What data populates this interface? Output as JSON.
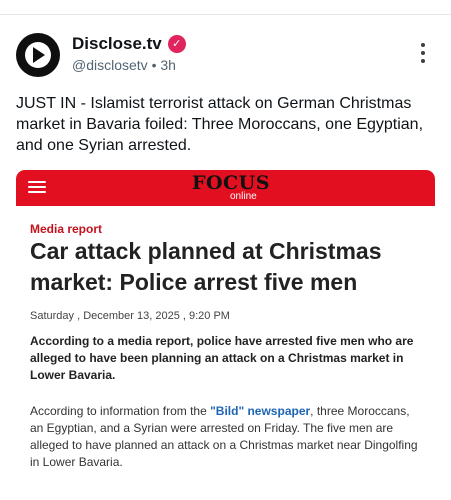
{
  "post": {
    "author": {
      "display_name": "Disclose.tv",
      "verified_mark": "✓",
      "handle": "@disclosetv",
      "separator": "•",
      "time": "3h"
    },
    "text": "JUST IN - Islamist terrorist attack on German Christmas market in Bavaria foiled: Three Moroccans, one Egyptian, and one Syrian arrested."
  },
  "card": {
    "logo_main": "FOCUS",
    "logo_sub": "online",
    "kicker": "Media report",
    "headline": "Car attack planned at Christmas market: Police arrest five men",
    "date": "Saturday , December 13, 2025 , 9:20 PM",
    "lead": "According to a media report, police have arrested five men who are alleged to have been planning an attack on a Christmas market in Lower Bavaria.",
    "body_before_link": "According to information from the ",
    "body_link": "\"Bild\" newspaper",
    "body_after_link": ", three Moroccans, an Egyptian, and a Syrian were arrested on Friday. The five men are alleged to have planned an attack on a Christmas market near Dingolfing in Lower Bavaria."
  },
  "icons": {
    "avatar": "play-logo-icon",
    "verified": "verified-badge-icon",
    "more": "more-vertical-icon",
    "menu": "hamburger-menu-icon"
  },
  "colors": {
    "card_bar": "#e10f1f",
    "kicker": "#c4121d",
    "link": "#1d64b5",
    "verified": "#e0245e"
  }
}
